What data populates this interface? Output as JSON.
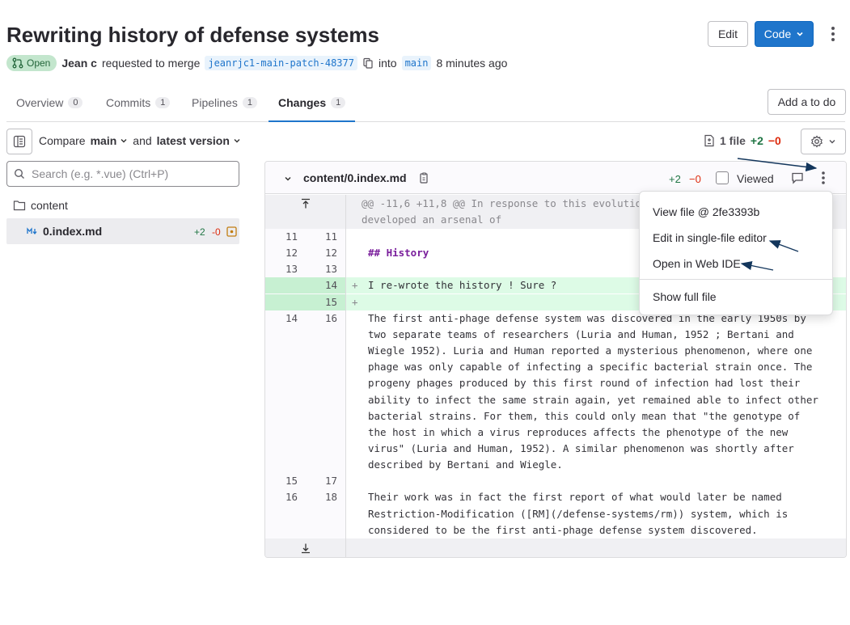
{
  "header": {
    "title": "Rewriting history of defense systems",
    "edit_label": "Edit",
    "code_label": "Code",
    "status": "Open",
    "author": "Jean c",
    "requested_text": "requested to merge",
    "source_branch": "jeanrjc1-main-patch-48377",
    "into_text": "into",
    "target_branch": "main",
    "time_ago": "8 minutes ago"
  },
  "tabs": [
    {
      "label": "Overview",
      "count": "0"
    },
    {
      "label": "Commits",
      "count": "1"
    },
    {
      "label": "Pipelines",
      "count": "1"
    },
    {
      "label": "Changes",
      "count": "1"
    }
  ],
  "add_todo_label": "Add a to do",
  "compare": {
    "compare_text": "Compare",
    "base": "main",
    "and_text": "and",
    "version": "latest version"
  },
  "file_stats": {
    "files": "1 file",
    "added": "+2",
    "removed": "−0"
  },
  "search": {
    "placeholder": "Search (e.g. *.vue) (Ctrl+P)"
  },
  "tree": {
    "folder": "content",
    "file": "0.index.md",
    "file_added": "+2",
    "file_removed": "-0"
  },
  "diff": {
    "file_path": "content/0.index.md",
    "added": "+2",
    "removed": "−0",
    "viewed_label": "Viewed",
    "hunk_header_1": "@@ -11,6 +11,8 @@ In response to this evolutio",
    "hunk_header_2": "developed an arsenal of",
    "lines": [
      {
        "old": "11",
        "new": "11",
        "marker": "",
        "text": ""
      },
      {
        "old": "12",
        "new": "12",
        "marker": "",
        "text": "## History"
      },
      {
        "old": "13",
        "new": "13",
        "marker": "",
        "text": ""
      },
      {
        "old": "",
        "new": "14",
        "marker": "+",
        "text": "I re-wrote the history ! Sure ?"
      },
      {
        "old": "",
        "new": "15",
        "marker": "+",
        "text": ""
      },
      {
        "old": "14",
        "new": "16",
        "marker": "",
        "text": "The first anti-phage defense system was discovered in the early 1950s by"
      },
      {
        "old": "",
        "new": "",
        "marker": "",
        "text": "two separate teams of researchers (Luria and Human, 1952 ; Bertani and"
      },
      {
        "old": "",
        "new": "",
        "marker": "",
        "text": "Wiegle 1952). Luria and Human reported a mysterious phenomenon, where one"
      },
      {
        "old": "",
        "new": "",
        "marker": "",
        "text": "phage was only capable of infecting a specific bacterial strain once. The"
      },
      {
        "old": "",
        "new": "",
        "marker": "",
        "text": "progeny phages produced by this first round of infection had lost their"
      },
      {
        "old": "",
        "new": "",
        "marker": "",
        "text": "ability to infect the same strain again, yet remained able to infect other"
      },
      {
        "old": "",
        "new": "",
        "marker": "",
        "text": "bacterial strains. For them, this could only mean that \"the genotype of"
      },
      {
        "old": "",
        "new": "",
        "marker": "",
        "text": "the host in which a virus reproduces affects the phenotype of the new"
      },
      {
        "old": "",
        "new": "",
        "marker": "",
        "text": "virus\" (Luria and Human, 1952). A similar phenomenon was shortly after"
      },
      {
        "old": "",
        "new": "",
        "marker": "",
        "text": "described by Bertani and Wiegle."
      },
      {
        "old": "15",
        "new": "17",
        "marker": "",
        "text": ""
      },
      {
        "old": "16",
        "new": "18",
        "marker": "",
        "text": "Their work was in fact the first report of what would later be named"
      },
      {
        "old": "",
        "new": "",
        "marker": "",
        "text": "Restriction-Modification ([RM](/defense-systems/rm)) system, which is"
      },
      {
        "old": "",
        "new": "",
        "marker": "",
        "text": "considered to be the first anti-phage defense system discovered."
      }
    ]
  },
  "menu": {
    "view_file": "View file @ 2fe3393b",
    "edit_single": "Edit in single-file editor",
    "open_ide": "Open in Web IDE",
    "show_full": "Show full file"
  },
  "colors": {
    "accent": "#1f75cb",
    "added_bg": "#ddfbe6",
    "added_text": "#217645",
    "removed_text": "#dd2b0e",
    "annotation_arrow": "#13365c"
  }
}
